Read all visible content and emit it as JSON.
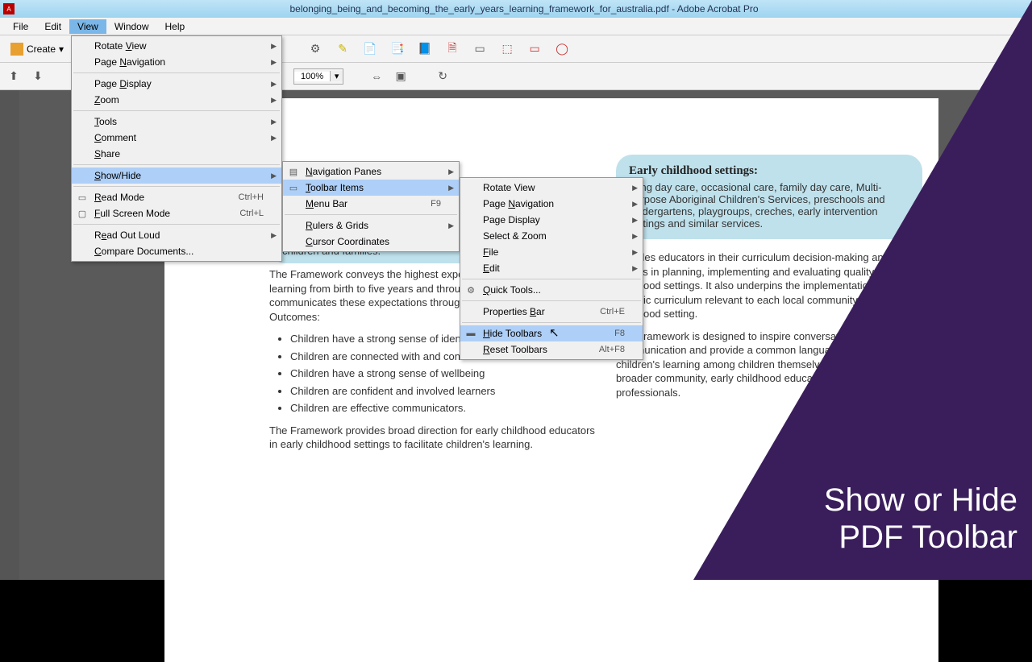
{
  "title": "belonging_being_and_becoming_the_early_years_learning_framework_for_australia.pdf - Adobe Acrobat Pro",
  "menubar": [
    "File",
    "Edit",
    "View",
    "Window",
    "Help"
  ],
  "menubar_active": 2,
  "toolbar": {
    "create": "Create",
    "zoom": "100%"
  },
  "view_menu": {
    "items": [
      {
        "label": "Rotate View",
        "u": "V",
        "sub": true
      },
      {
        "label": "Page Navigation",
        "u": "N",
        "sub": true
      },
      {
        "sep": true
      },
      {
        "label": "Page Display",
        "u": "D",
        "sub": true
      },
      {
        "label": "Zoom",
        "u": "Z",
        "sub": true
      },
      {
        "sep": true
      },
      {
        "label": "Tools",
        "u": "T",
        "sub": true
      },
      {
        "label": "Comment",
        "u": "C",
        "sub": true
      },
      {
        "label": "Share",
        "u": "S"
      },
      {
        "sep": true
      },
      {
        "label": "Show/Hide",
        "u": "S",
        "sub": true,
        "hov": true
      },
      {
        "sep": true
      },
      {
        "label": "Read Mode",
        "u": "R",
        "sc": "Ctrl+H",
        "ico": "▭"
      },
      {
        "label": "Full Screen Mode",
        "u": "F",
        "sc": "Ctrl+L",
        "ico": "▢"
      },
      {
        "sep": true
      },
      {
        "label": "Read Out Loud",
        "u": "e",
        "sub": true
      },
      {
        "label": "Compare Documents...",
        "u": "C"
      }
    ]
  },
  "showhide_menu": {
    "items": [
      {
        "label": "Navigation Panes",
        "u": "N",
        "sub": true,
        "ico": "▤"
      },
      {
        "label": "Toolbar Items",
        "u": "T",
        "sub": true,
        "hov": true,
        "ico": "▭"
      },
      {
        "label": "Menu Bar",
        "u": "M",
        "sc": "F9"
      },
      {
        "sep": true
      },
      {
        "label": "Rulers & Grids",
        "u": "R",
        "sub": true
      },
      {
        "label": "Cursor Coordinates",
        "u": "C"
      }
    ]
  },
  "toolbaritems_menu": {
    "items": [
      {
        "label": "Rotate View",
        "sub": true
      },
      {
        "label": "Page Navigation",
        "u": "N",
        "sub": true
      },
      {
        "label": "Page Display",
        "sub": true
      },
      {
        "label": "Select & Zoom",
        "sub": true
      },
      {
        "label": "File",
        "u": "F",
        "sub": true
      },
      {
        "label": "Edit",
        "u": "E",
        "sub": true
      },
      {
        "sep": true
      },
      {
        "label": "Quick Tools...",
        "u": "Q",
        "ico": "⚙"
      },
      {
        "sep": true
      },
      {
        "label": "Properties Bar",
        "u": "B",
        "sc": "Ctrl+E"
      },
      {
        "sep": true
      },
      {
        "label": "Hide Toolbars",
        "u": "H",
        "sc": "F8",
        "hov": true,
        "ico": "▬"
      },
      {
        "label": "Reset Toolbars",
        "u": "R",
        "sc": "Alt+F8"
      }
    ]
  },
  "doc": {
    "bb_left_title": "children and families.",
    "bb_right_title": "Early childhood settings:",
    "bb_right_body": "Long day care, occasional care, family day care, Multi-purpose Aboriginal Children's Services, preschools and kindergartens, playgroups, creches, early intervention settings and similar services.",
    "p1": "The Framework conveys the highest expectations for all children's learning from birth to five years and through the transitions to school. It communicates these expectations through the following five Learning Outcomes:",
    "b1": "Children have a strong sense of identity",
    "b2": "Children are connected with and contribute to their world",
    "b3": "Children have a strong sense of wellbeing",
    "b4": "Children are confident and involved learners",
    "b5": "Children are effective communicators.",
    "p2": "The Framework provides broad direction for early childhood educators in early childhood settings to facilitate children's learning.",
    "r1": "It guides educators in their curriculum decision-making and assists in planning, implementing and evaluating quality in early childhood settings. It also underpins the implementation of more specific curriculum relevant to each local community and early childhood setting.",
    "r2": "The Framework is designed to inspire conversations, improve communication and provide a common language about young children's learning among children themselves, their families, the broader community, early childhood educators and other professionals."
  },
  "overlay": {
    "l1": "Show or Hide",
    "l2": "PDF Toolbar"
  }
}
